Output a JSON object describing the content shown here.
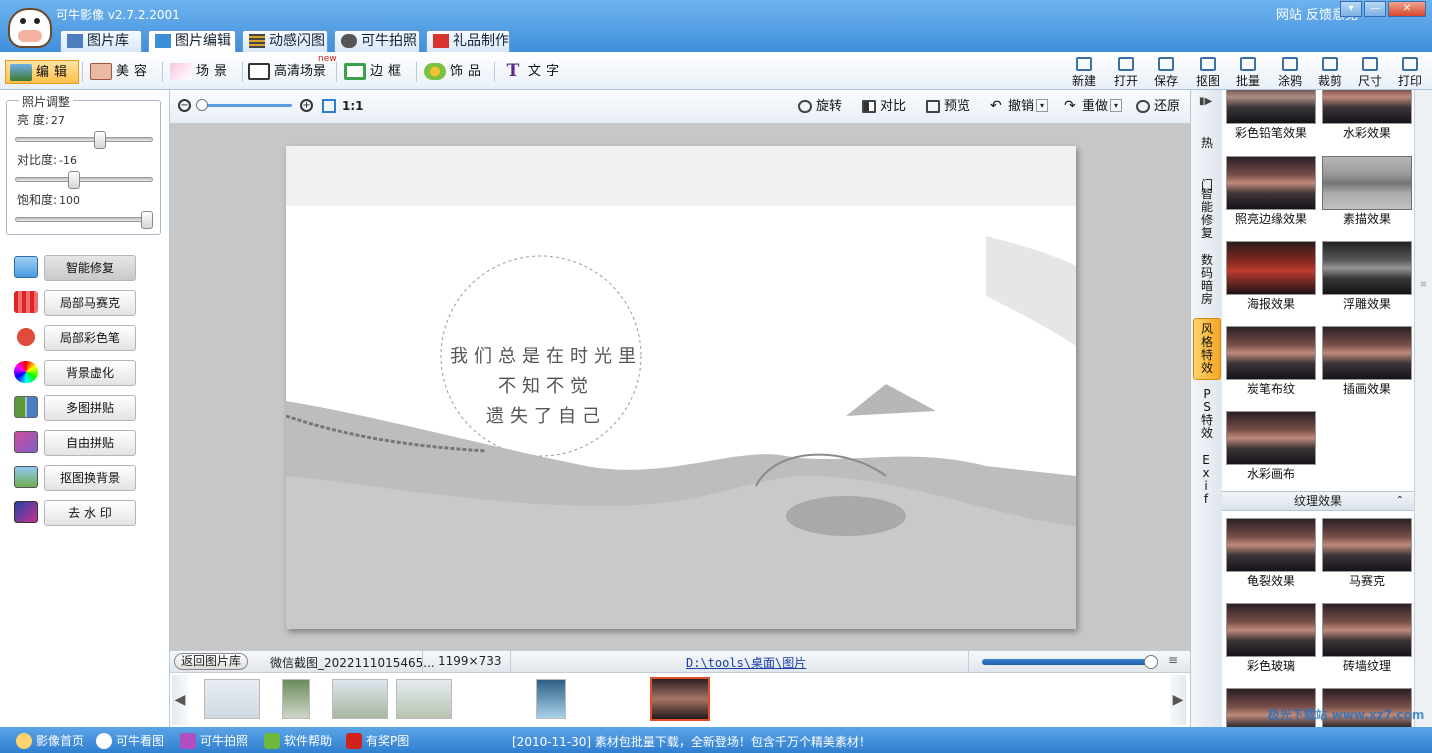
{
  "app": {
    "title": "可牛影像  v2.7.2.2001",
    "links": "网站  反馈意见"
  },
  "main_tabs": [
    {
      "label": "图片库",
      "icon": "gallery-icon"
    },
    {
      "label": "图片编辑",
      "icon": "edit-photo-icon"
    },
    {
      "label": "动感闪图",
      "icon": "film-icon"
    },
    {
      "label": "可牛拍照",
      "icon": "camera-icon"
    },
    {
      "label": "礼品制作",
      "icon": "gift-icon"
    }
  ],
  "edit_tools": [
    {
      "label": "编辑"
    },
    {
      "label": "美容"
    },
    {
      "label": "场景"
    },
    {
      "label": "高清场景",
      "badge": "new"
    },
    {
      "label": "边框"
    },
    {
      "label": "饰品"
    },
    {
      "label": "文字"
    }
  ],
  "right_tools": [
    "新建",
    "打开",
    "保存",
    "抠图",
    "批量",
    "涂鸦",
    "裁剪",
    "尺寸",
    "打印"
  ],
  "adjust": {
    "title": "照片调整",
    "brightness_label": "亮  度:",
    "brightness": "27",
    "brightness_level": 0.63,
    "contrast_label": "对比度:",
    "contrast": "-16",
    "contrast_level": 0.42,
    "saturation_label": "饱和度:",
    "saturation": "100",
    "saturation_level": 1.0
  },
  "left_buttons": [
    "智能修复",
    "局部马赛克",
    "局部彩色笔",
    "背景虚化",
    "多图拼贴",
    "自由拼贴",
    "抠图换背景",
    "去 水 印"
  ],
  "canvas_toolbar": {
    "zoom_fit": "1:1",
    "rotate": "旋转",
    "compare": "对比",
    "preview": "预览",
    "undo": "撤销",
    "redo": "重做",
    "restore": "还原",
    "zoom_level": 1.0
  },
  "photo_text": [
    "我们总是在时光里",
    "不知不觉",
    "遗失了自己"
  ],
  "info_bar": {
    "back": "返回图片库",
    "filename": "微信截图_2022111015465...",
    "dimensions": "1199×733",
    "path": "D:\\tools\\桌面\\图片"
  },
  "side_tabs": [
    "热门",
    "智能修复",
    "数码暗房",
    "风格特效",
    "PS特效",
    "Exif"
  ],
  "effects": [
    "彩色铅笔效果",
    "水彩效果",
    "照亮边缘效果",
    "素描效果",
    "海报效果",
    "浮雕效果",
    "炭笔布纹",
    "插画效果",
    "水彩画布"
  ],
  "texture_section": {
    "title": "纹理效果",
    "items": [
      "龟裂效果",
      "马赛克",
      "彩色玻璃",
      "砖墙纹理"
    ]
  },
  "statusbar": {
    "items": [
      "影像首页",
      "可牛看图",
      "可牛拍照",
      "软件帮助",
      "有奖P图"
    ],
    "message": "[2010-11-30] 素材包批量下载，全新登场！包含千万个精美素材！",
    "watermark": "极光下载站 www.xz7.com"
  }
}
